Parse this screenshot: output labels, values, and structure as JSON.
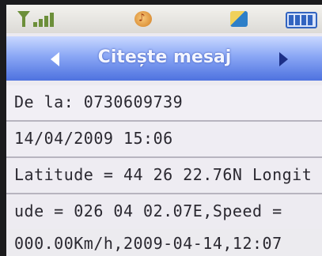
{
  "header": {
    "title": "Citește mesaj"
  },
  "message": {
    "from": "De la: 0730609739",
    "datetime": "14/04/2009 15:06",
    "body_lines": [
      "Latitude = 44 26 22.76N Longit",
      "ude = 026 04 02.07E,Speed =",
      "000.00Km/h,2009-04-14,12:07"
    ]
  },
  "status": {
    "signal_bars": 4,
    "battery_level": 1.0
  }
}
